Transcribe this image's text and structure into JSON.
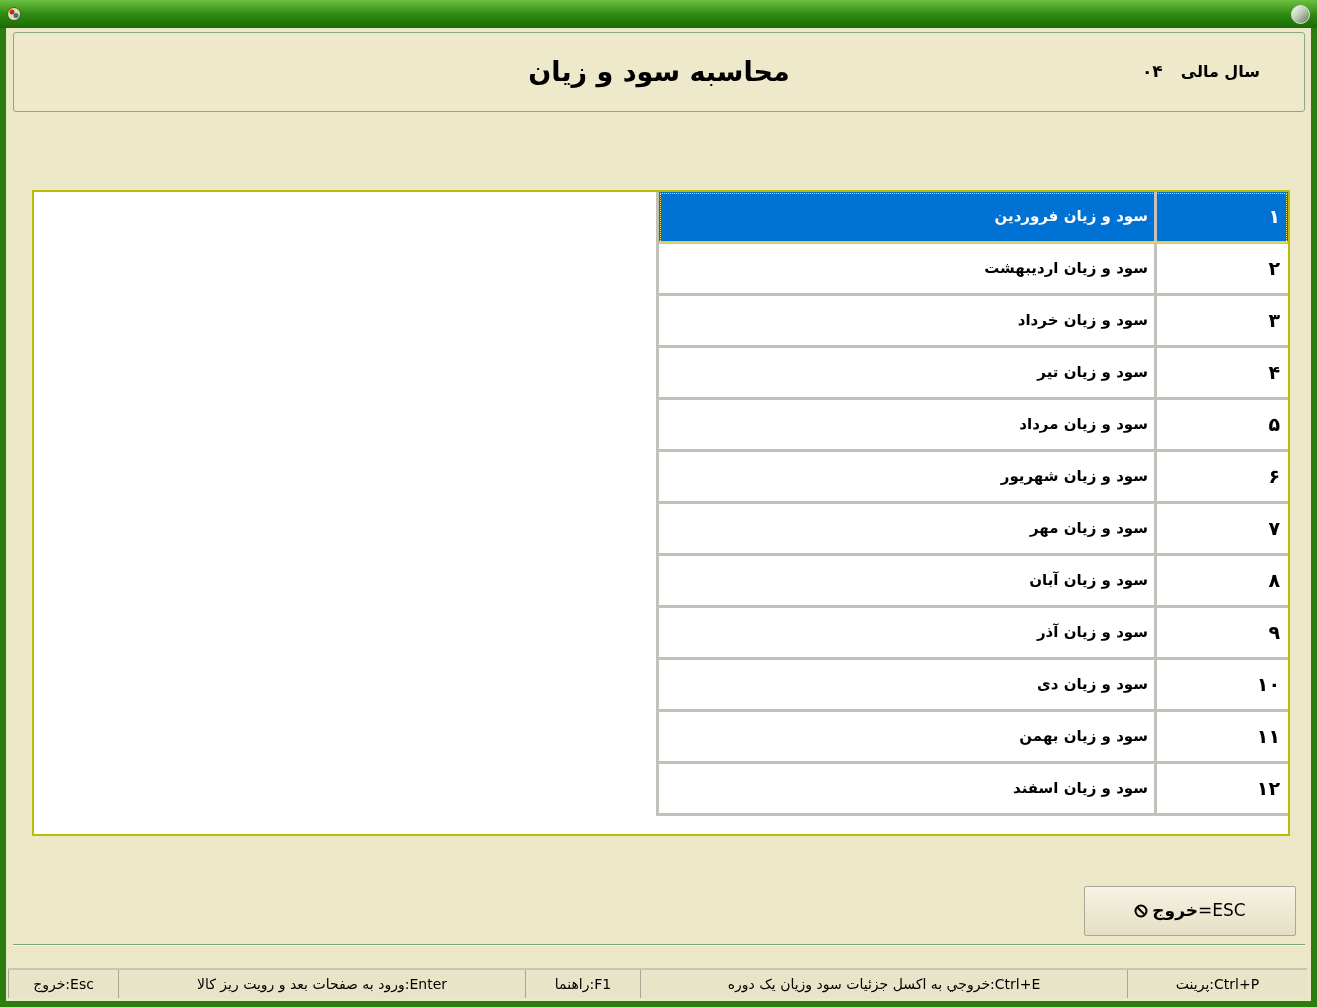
{
  "header": {
    "title": "محاسبه سود و زیان",
    "fiscal_year_label": "سال مالی",
    "fiscal_year": "۰۴"
  },
  "periods": {
    "rows": [
      {
        "number": "۱",
        "name": "سود و زیان فروردین",
        "selected": true
      },
      {
        "number": "۲",
        "name": "سود و زیان اردیبهشت",
        "selected": false
      },
      {
        "number": "۳",
        "name": "سود و زیان خرداد",
        "selected": false
      },
      {
        "number": "۴",
        "name": "سود و زیان تیر",
        "selected": false
      },
      {
        "number": "۵",
        "name": "سود و زیان مرداد",
        "selected": false
      },
      {
        "number": "۶",
        "name": "سود و زیان شهریور",
        "selected": false
      },
      {
        "number": "۷",
        "name": "سود و زیان مهر",
        "selected": false
      },
      {
        "number": "۸",
        "name": "سود و زیان آبان",
        "selected": false
      },
      {
        "number": "۹",
        "name": "سود و زیان آذر",
        "selected": false
      },
      {
        "number": "۱۰",
        "name": "سود و زیان دی",
        "selected": false
      },
      {
        "number": "۱۱",
        "name": "سود و زیان بهمن",
        "selected": false
      },
      {
        "number": "۱۲",
        "name": "سود و زیان اسفند",
        "selected": false
      }
    ]
  },
  "exit_button": {
    "label": "ESC=**خروج**"
  },
  "status_bar": [
    "Ctrl+P:پرینت",
    "Ctrl+E:خروجي به اکسل جزئیات سود وزیان یک دوره",
    "F1:راهنما",
    "Enter:ورود به صفحات بعد و رویت ریز کالا",
    "Esc:خروج"
  ]
}
